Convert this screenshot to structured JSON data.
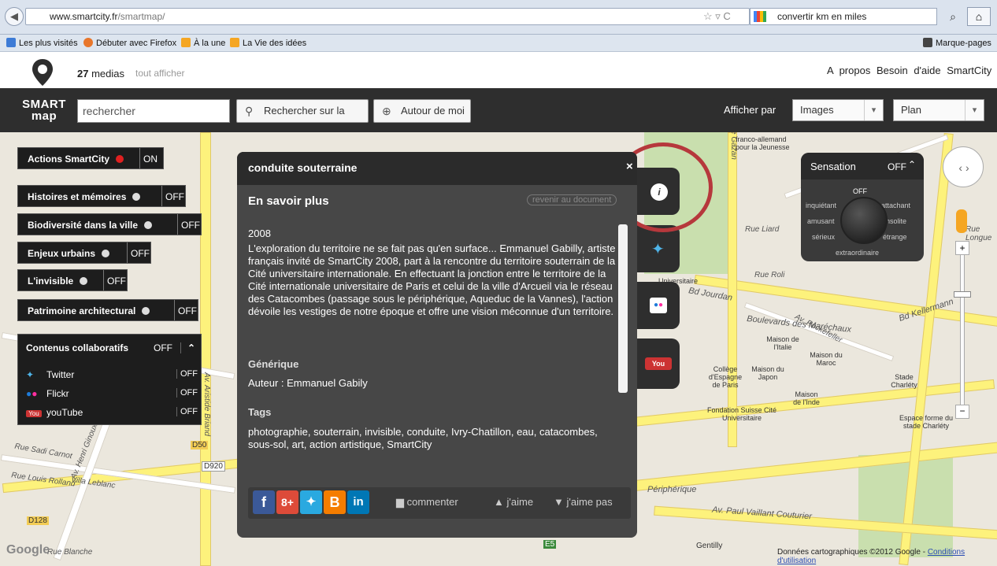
{
  "browser": {
    "url_domain": "www.smartcity.fr",
    "url_path": "/smartmap/",
    "search_value": "convertir km en miles",
    "bookmarks": [
      "Les plus visités",
      "Débuter avec Firefox",
      "À la une",
      "La Vie des idées"
    ],
    "bookmarks_menu": "Marque-pages"
  },
  "site": {
    "logo_line1": "SMART",
    "logo_line2": "map",
    "media_count": "27",
    "media_label": "medias",
    "show_all": "tout afficher",
    "links": [
      "A propos",
      "Besoin d'aide",
      "SmartCity"
    ],
    "search_placeholder": "rechercher",
    "search_button": "Rechercher sur la",
    "around_button": "Autour de moi",
    "display_by": "Afficher par",
    "display_select": "Images",
    "map_select": "Plan"
  },
  "filters": [
    {
      "label": "Actions SmartCity",
      "state": "ON",
      "dot_color": "#e02020"
    },
    {
      "label": "Histoires et mémoires",
      "state": "OFF",
      "dot_color": "#dddddd"
    },
    {
      "label": "Biodiversité dans la ville",
      "state": "OFF",
      "dot_color": "#dddddd"
    },
    {
      "label": "Enjeux urbains",
      "state": "OFF",
      "dot_color": "#dddddd"
    },
    {
      "label": "L'invisible",
      "state": "OFF",
      "dot_color": "#dddddd"
    },
    {
      "label": "Patrimoine architectural",
      "state": "OFF",
      "dot_color": "#dddddd"
    }
  ],
  "collab": {
    "title": "Contenus collaboratifs",
    "state": "OFF",
    "items": [
      {
        "label": "Twitter",
        "state": "OFF",
        "icon": "twitter-icon"
      },
      {
        "label": "Flickr",
        "state": "OFF",
        "icon": "flickr-icon"
      },
      {
        "label": "youTube",
        "state": "OFF",
        "icon": "youtube-icon"
      }
    ]
  },
  "panel": {
    "title": "conduite souterraine",
    "close": "×",
    "section": "En savoir plus",
    "back_link": "revenir au document",
    "year": "2008",
    "description": "L'exploration du territoire ne se fait pas qu'en surface... Emmanuel Gabilly, artiste français invité de SmartCity 2008, part à la rencontre du territoire souterrain de la Cité universitaire internationale. En effectuant la jonction entre le territoire de la Cité internationale universitaire de Paris et celui de la ville d'Arcueil via le réseau des Catacombes (passage sous le périphérique, Aqueduc de la Vannes), l'action dévoile les vestiges de notre époque et offre une vision méconnue d'un territoire.",
    "credits_heading": "Générique",
    "credits": "Auteur : Emmanuel Gabily",
    "tags_heading": "Tags",
    "tags": "photographie, souterrain, invisible, conduite, Ivry-Chatillon, eau, catacombes, sous-sol, art, action artistique, SmartCity",
    "comment": "commenter",
    "like": "j'aime",
    "dislike": "j'aime pas"
  },
  "sensation": {
    "title": "Sensation",
    "state": "OFF",
    "words": [
      "OFF",
      "inquiétant",
      "attachant",
      "amusant",
      "insolite",
      "sérieux",
      "étrange",
      "extraordinaire"
    ]
  },
  "map": {
    "labels": [
      "Rue Gazan",
      "franco-allemand pour la Jeunesse",
      "Rue Liard",
      "Rue Roli",
      "Universitaire",
      "Bd Jourdan",
      "Boulevards des Maréchaux",
      "Bd Kellermann",
      "Maison de l'Italie",
      "Maison du Maroc",
      "Collège d'Espagne de Paris",
      "Maison du Japon",
      "Maison de l'Inde",
      "Fondation Suisse Cité Universitaire",
      "Stade Charléty",
      "Espace forme du stade Charléty",
      "Périphérique",
      "Av. Paul Vaillant Couturier",
      "Gentilly",
      "Rue Sadi Carnot",
      "Rue Louis Rolland",
      "Villa Leblanc",
      "Av. Henri Ginoux",
      "Av. Aristide Briand",
      "D50",
      "D920",
      "D128",
      "E5",
      "Rue Blanche",
      "Av. Rockefeller",
      "Rue Longue"
    ],
    "copyright": "Données cartographiques ©2012 Google -",
    "terms": "Conditions d'utilisation",
    "google": "Google"
  }
}
